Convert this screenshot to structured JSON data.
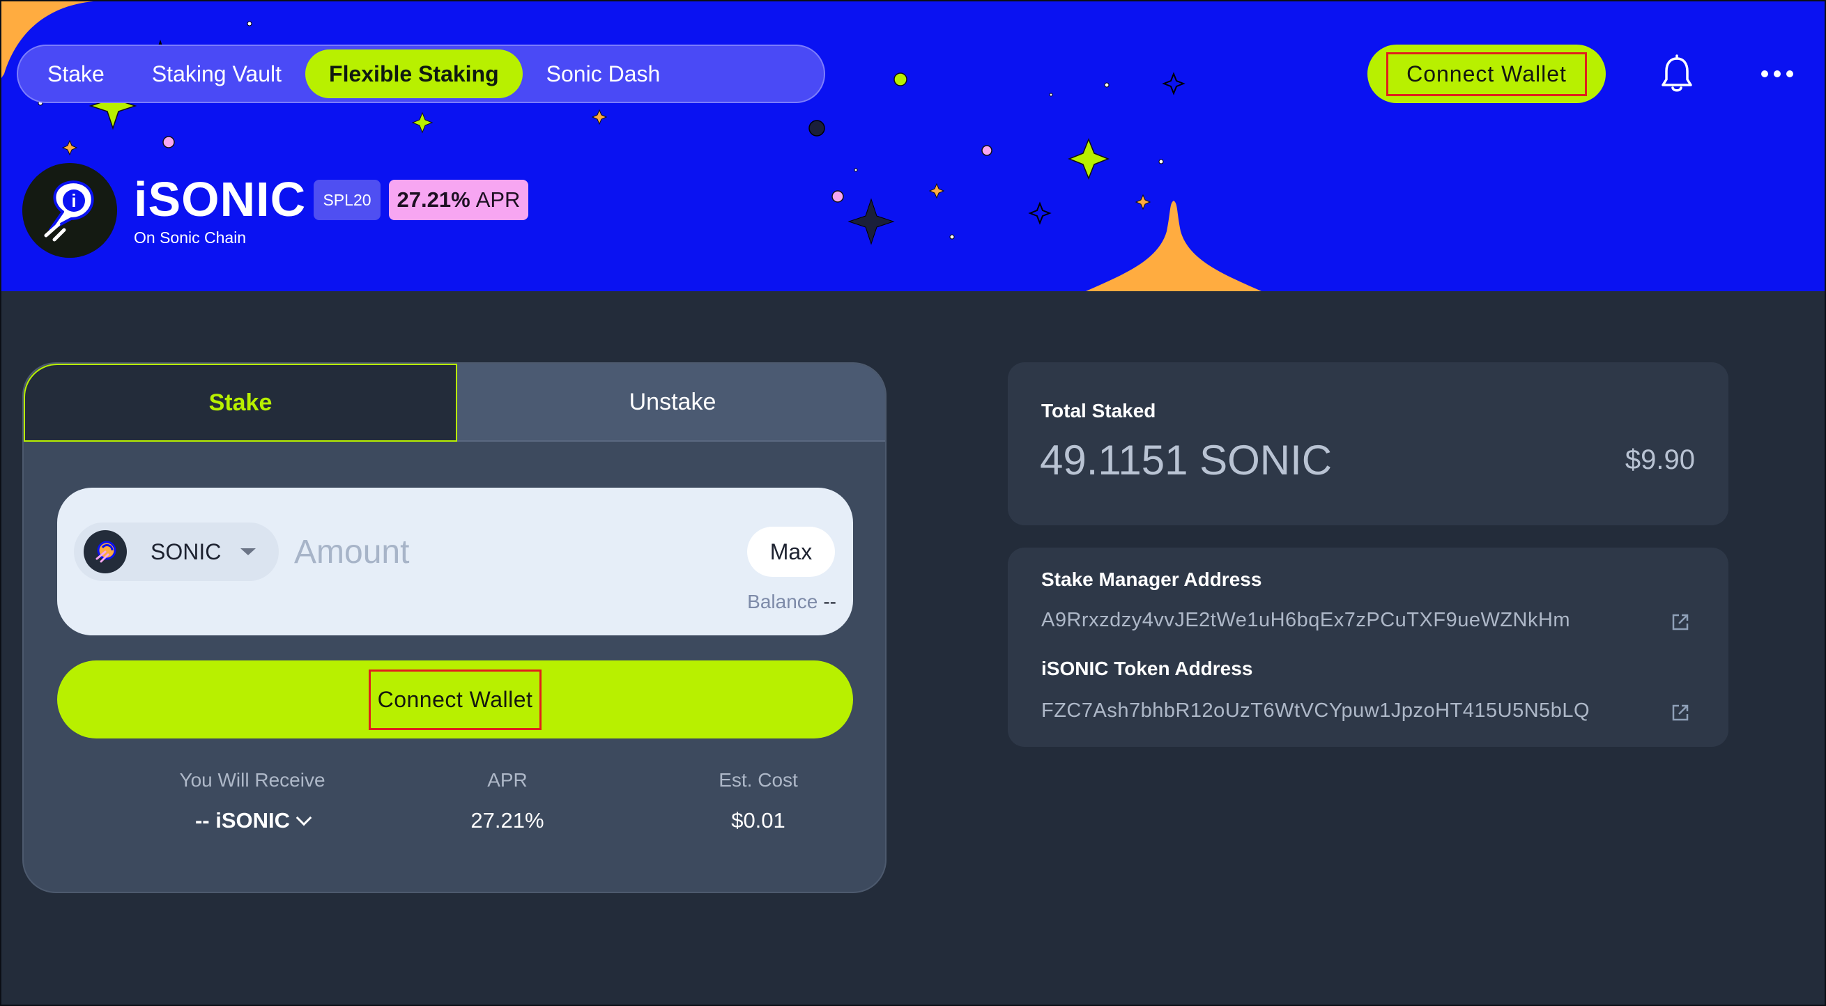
{
  "nav": {
    "tabs": [
      {
        "label": "Stake"
      },
      {
        "label": "Staking Vault"
      },
      {
        "label": "Flexible Staking"
      },
      {
        "label": "Sonic Dash"
      }
    ]
  },
  "header": {
    "connect_label": "Connect Wallet",
    "icons": [
      "bell-icon",
      "more-icon"
    ]
  },
  "token": {
    "name": "iSONIC",
    "subtitle": "On Sonic Chain",
    "standard_badge": "SPL20",
    "apr_value": "27.21%",
    "apr_label": "APR"
  },
  "stake_card": {
    "tabs": {
      "stake": "Stake",
      "unstake": "Unstake"
    },
    "selected_token": "SONIC",
    "amount_placeholder": "Amount",
    "max_label": "Max",
    "balance_label": "Balance",
    "balance_value": "--",
    "connect_label": "Connect Wallet",
    "stats": {
      "receive_label": "You Will Receive",
      "receive_prefix": "--",
      "receive_token": "iSONIC",
      "apr_label": "APR",
      "apr_value": "27.21%",
      "cost_label": "Est. Cost",
      "cost_value": "$0.01"
    }
  },
  "total_staked": {
    "label": "Total Staked",
    "amount": "49.1151 SONIC",
    "usd": "$9.90"
  },
  "addresses": {
    "manager_label": "Stake Manager Address",
    "manager_value": "A9Rrxzdzy4vvJE2tWe1uH6bqEx7zPCuTXF9ueWZNkHm",
    "token_label": "iSONIC Token Address",
    "token_value": "FZC7Ash7bhbR12oUzT6WtVCYpuw1JpzoHT415U5N5bLQ"
  },
  "colors": {
    "hero_blue": "#0a12f2",
    "accent_lime": "#b8f000",
    "apr_pink": "#f7a6f2",
    "page_bg": "#232c3a",
    "orange": "#ffac40"
  }
}
